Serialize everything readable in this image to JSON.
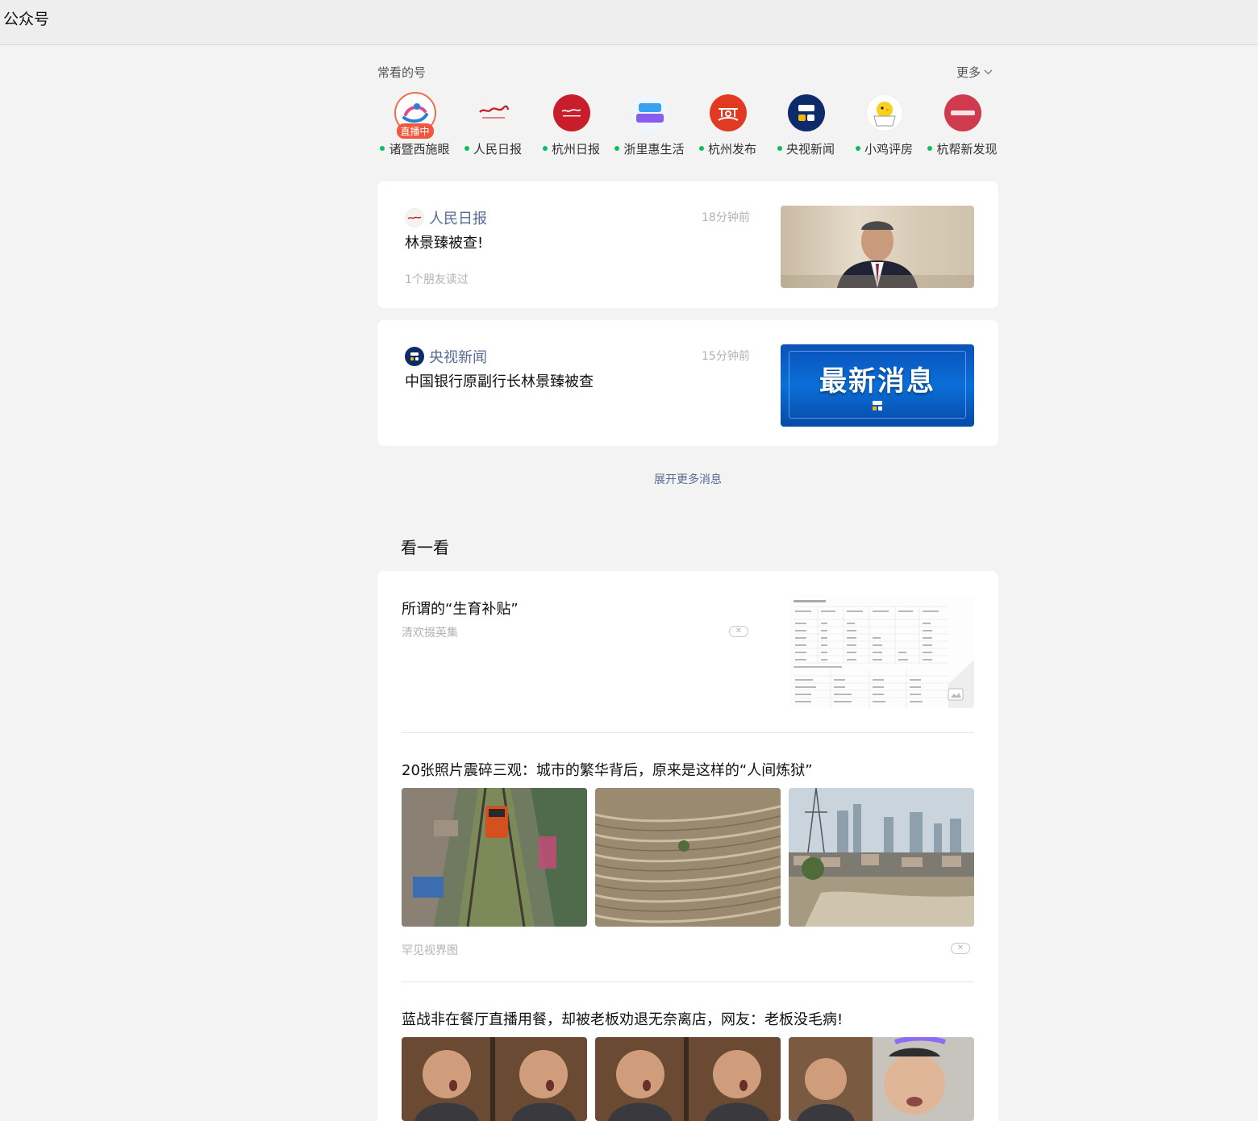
{
  "window": {
    "title": "公众号"
  },
  "frequent": {
    "label": "常看的号",
    "more_label": "更多",
    "accounts": [
      {
        "name": "诸暨西施眼",
        "live": true,
        "live_label": "直播中"
      },
      {
        "name": "人民日报",
        "live": false
      },
      {
        "name": "杭州日报",
        "live": false
      },
      {
        "name": "浙里惠生活",
        "live": false
      },
      {
        "name": "杭州发布",
        "live": false
      },
      {
        "name": "央视新闻",
        "live": false
      },
      {
        "name": "小鸡评房",
        "live": false
      },
      {
        "name": "杭帮新发现",
        "live": false
      }
    ]
  },
  "messages": [
    {
      "source": "人民日报",
      "time": "18分钟前",
      "title": "林景臻被查!",
      "read_by": "1个朋友读过"
    },
    {
      "source": "央视新闻",
      "time": "15分钟前",
      "title": "中国银行原副行长林景臻被查",
      "thumb_text": "最新消息"
    }
  ],
  "expand_label": "展开更多消息",
  "kankan": {
    "title": "看一看",
    "items": [
      {
        "title": "所谓的“生育补贴”",
        "source": "清欢掇英集"
      },
      {
        "title": "20张照片震碎三观：城市的繁华背后，原来是这样的“人间炼狱”",
        "source": "罕见视界图"
      },
      {
        "title": "蓝战非在餐厅直播用餐，却被老板劝退无奈离店，网友：老板没毛病!"
      }
    ]
  },
  "colors": {
    "accent_link": "#576b95",
    "online_dot": "#07c160",
    "live_red": "#f1573f"
  }
}
